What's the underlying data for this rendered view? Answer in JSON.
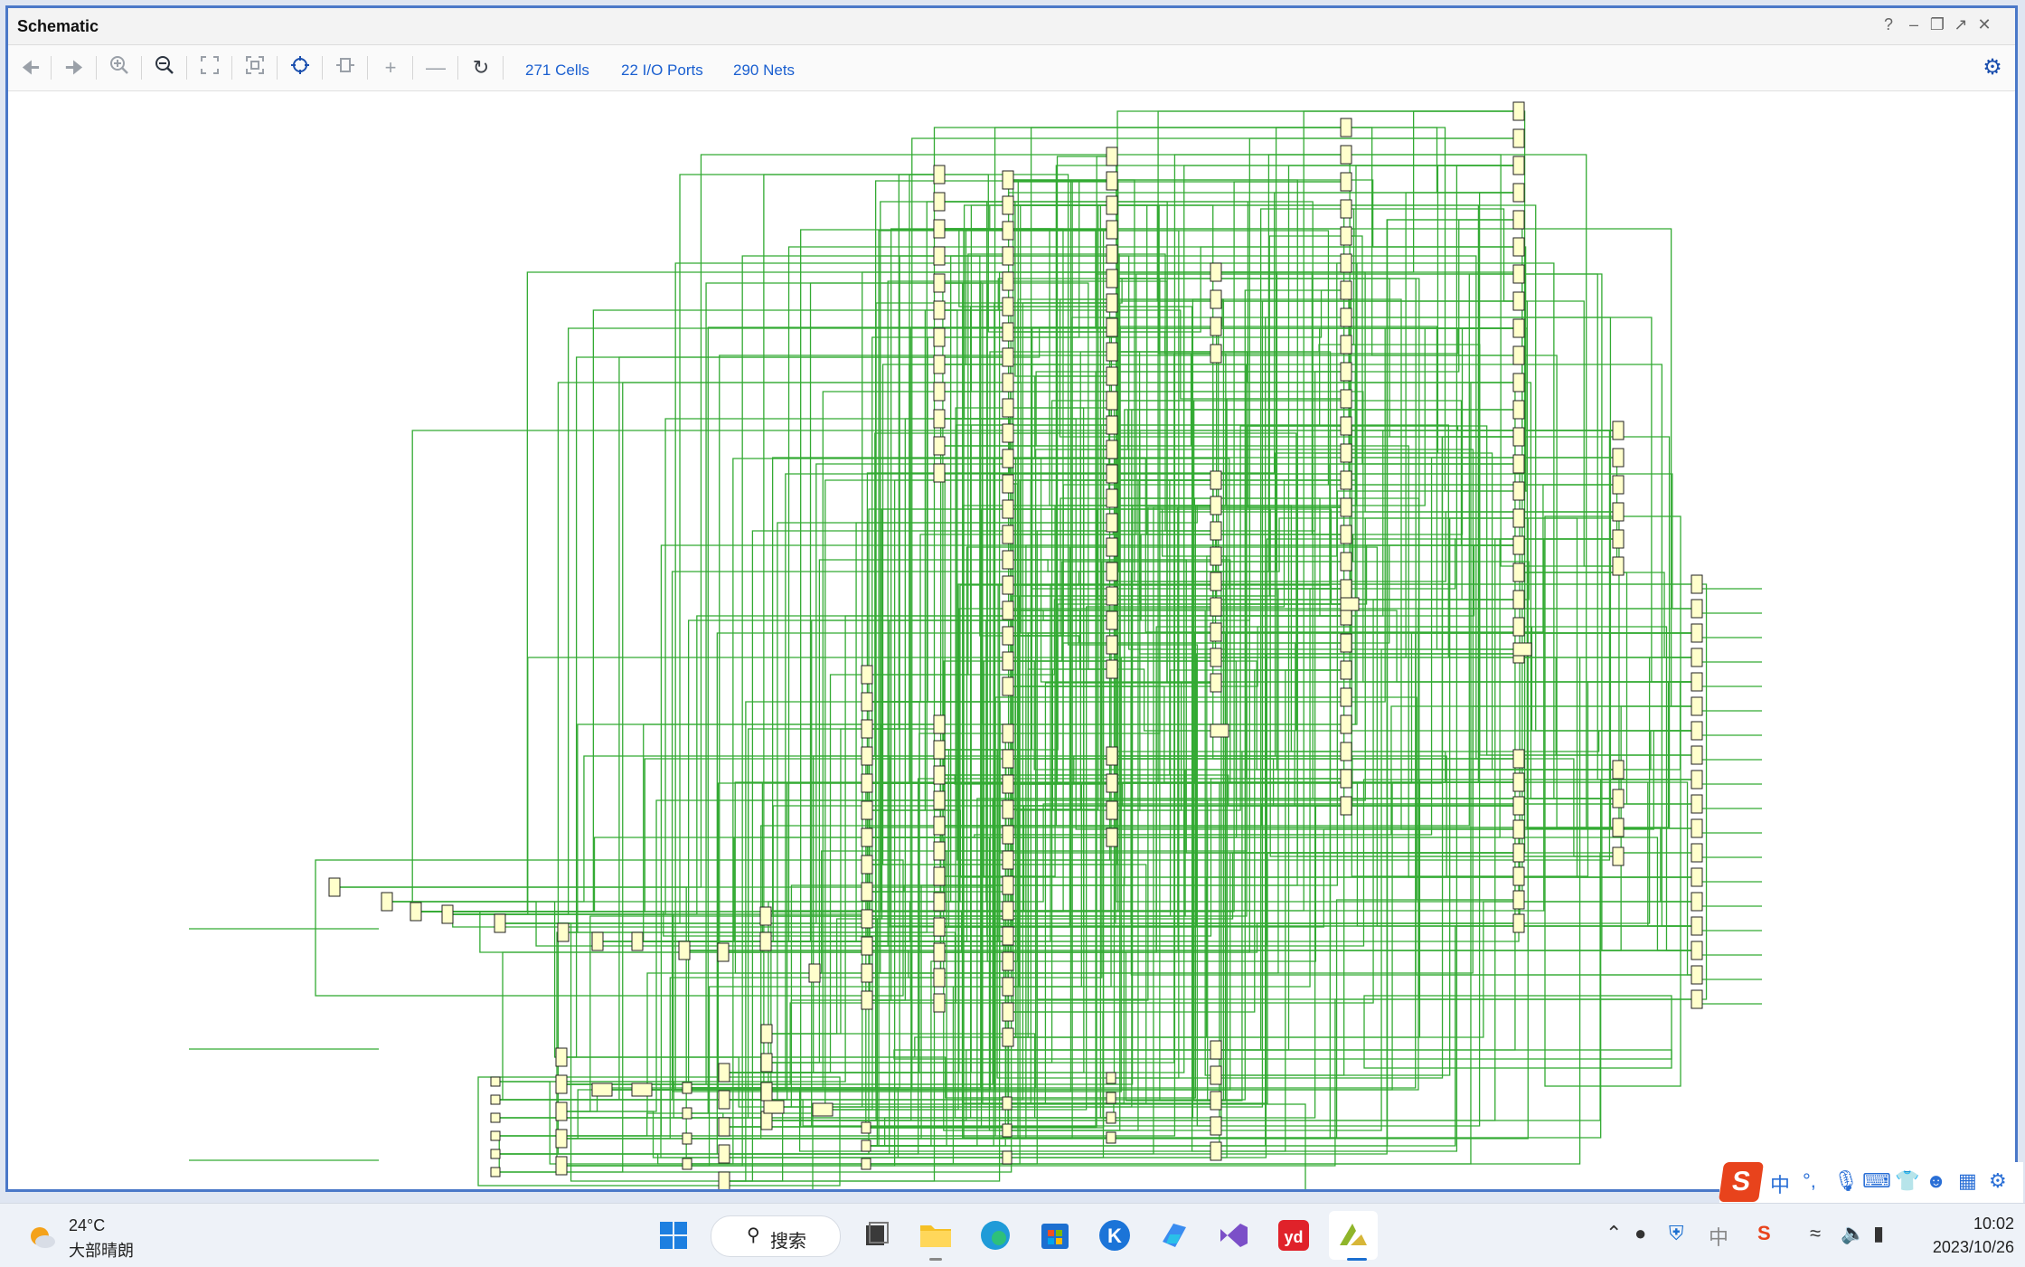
{
  "window": {
    "title": "Schematic",
    "controls": [
      "?",
      "minimize",
      "restore",
      "maximize",
      "close"
    ]
  },
  "toolbar": {
    "buttons": [
      {
        "icon": "back-arrow-icon"
      },
      {
        "icon": "forward-arrow-icon"
      },
      {
        "icon": "zoom-in-icon"
      },
      {
        "icon": "zoom-out-icon"
      },
      {
        "icon": "zoom-fit-icon"
      },
      {
        "icon": "zoom-area-icon"
      },
      {
        "icon": "select-area-icon"
      },
      {
        "icon": "cell-icon"
      },
      {
        "icon": "expand-icon"
      },
      {
        "icon": "collapse-icon"
      },
      {
        "icon": "refresh-icon"
      }
    ],
    "cells": "271 Cells",
    "ports": "22 I/O Ports",
    "nets": "290 Nets",
    "settings_icon": "gear-icon"
  },
  "schematic": {
    "wire_color": "#33aa33",
    "cell_color": "#ffffcc"
  },
  "ime": {
    "logo": "S",
    "mode": "中"
  },
  "taskbar": {
    "temperature": "24°C",
    "weather": "大部晴朗",
    "search_label": "搜索",
    "time": "10:02",
    "date": "2023/10/26",
    "apps": [
      "windows-start-icon",
      "search-icon",
      "task-view-icon",
      "file-explorer-icon",
      "edge-icon",
      "store-icon",
      "k-app-icon",
      "copilot-icon",
      "visual-studio-icon",
      "youdao-icon",
      "vivado-icon"
    ]
  }
}
